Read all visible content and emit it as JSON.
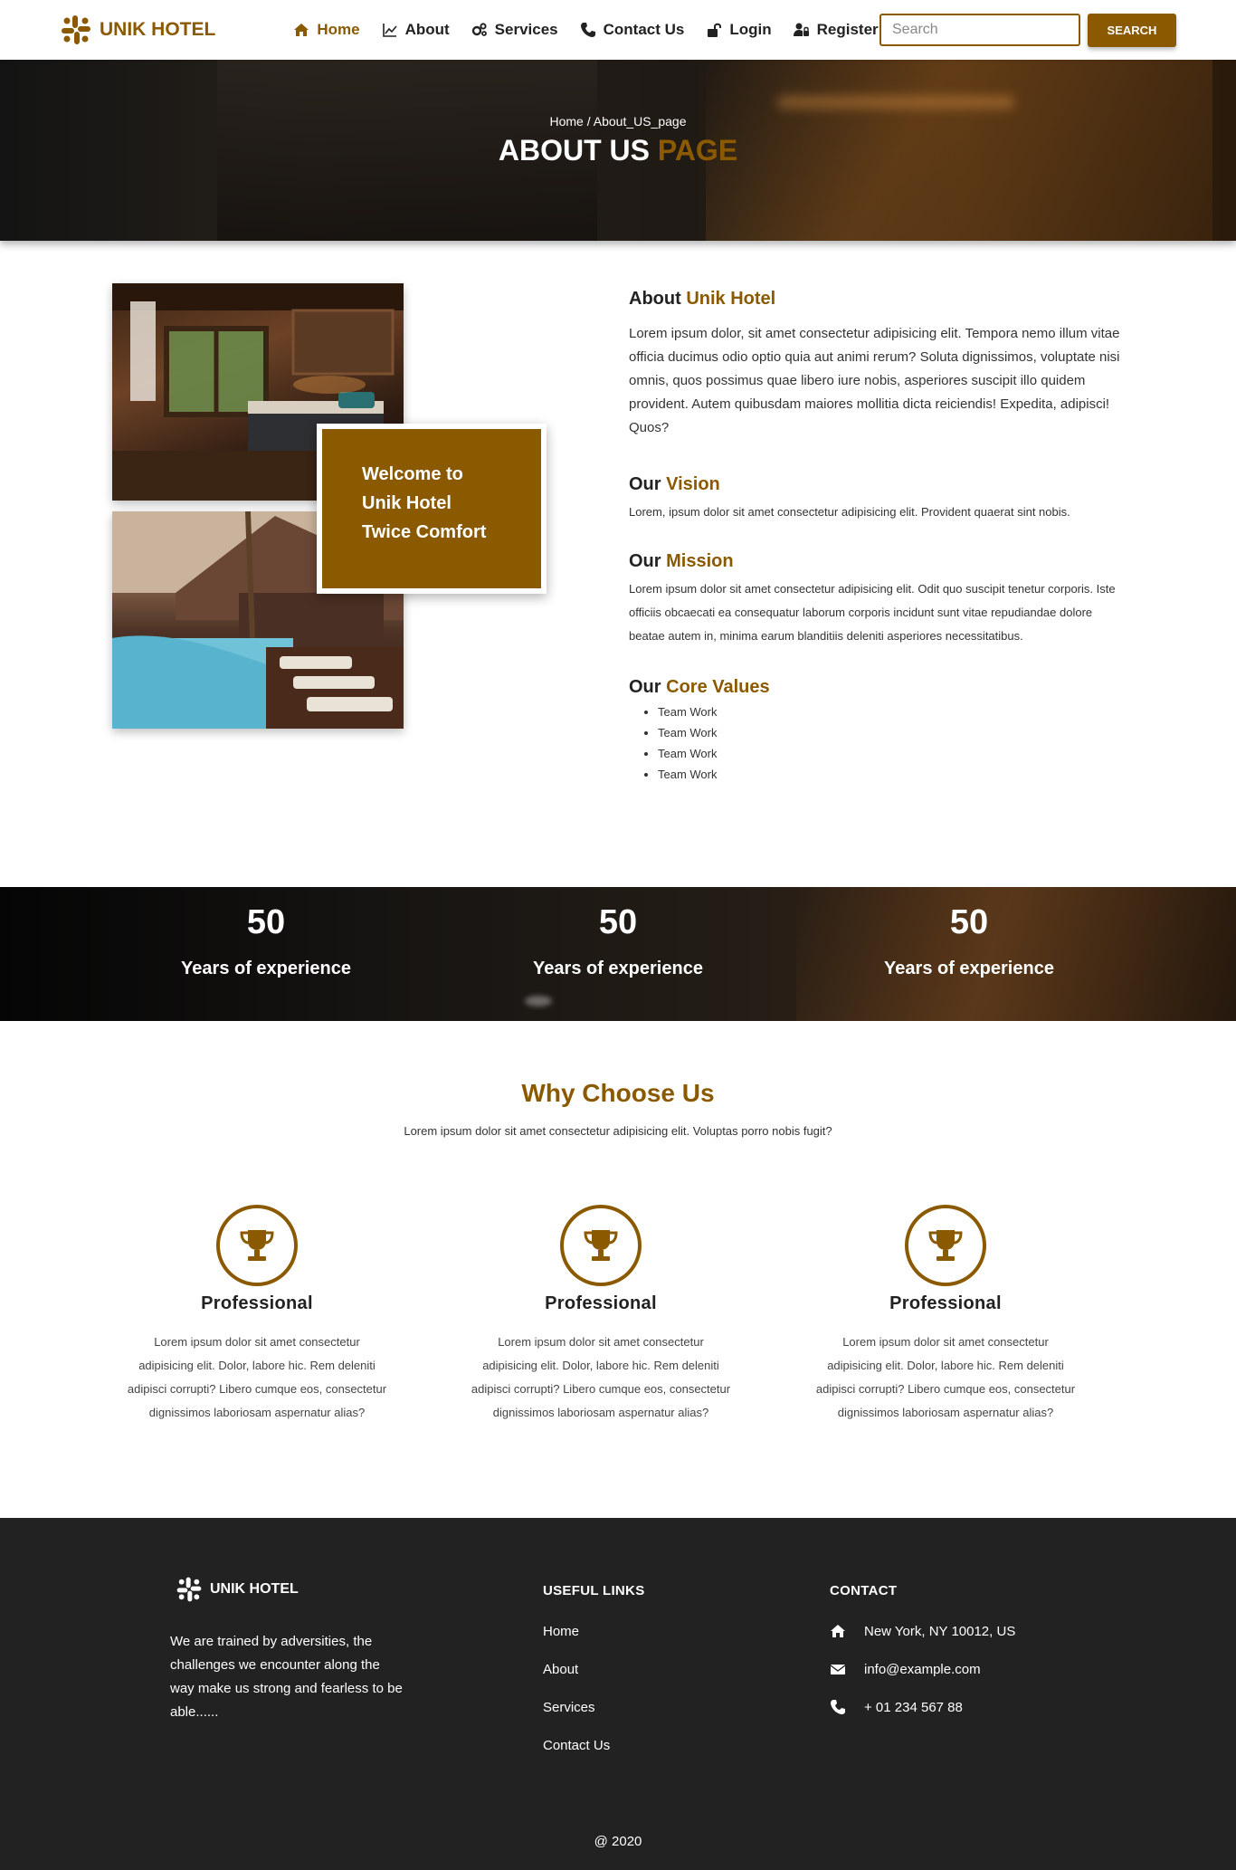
{
  "nav": {
    "brand": "UNIK HOTEL",
    "links": [
      "Home",
      "About",
      "Services",
      "Contact Us",
      "Login",
      "Register"
    ],
    "search_placeholder": "Search",
    "search_button": "SEARCH"
  },
  "hero": {
    "breadcrumb": "Home / About_US_page",
    "title_main": "ABOUT US",
    "title_accent": "PAGE"
  },
  "about": {
    "welcome_lines": [
      "Welcome to",
      "Unik Hotel",
      "Twice Comfort"
    ],
    "heading_main": "About",
    "heading_accent": "Unik Hotel",
    "paragraph": "Lorem ipsum dolor, sit amet consectetur adipisicing elit. Tempora nemo illum vitae officia ducimus odio optio quia aut animi rerum? Soluta dignissimos, voluptate nisi omnis, quos possimus quae libero iure nobis, asperiores suscipit illo quidem provident. Autem quibusdam maiores mollitia dicta reiciendis! Expedita, adipisci! Quos?",
    "vision": {
      "prefix": "Our",
      "accent": "Vision",
      "text": "Lorem, ipsum dolor sit amet consectetur adipisicing elit. Provident quaerat sint nobis."
    },
    "mission": {
      "prefix": "Our",
      "accent": "Mission",
      "text": "Lorem ipsum dolor sit amet consectetur adipisicing elit. Odit quo suscipit tenetur corporis. Iste officiis obcaecati ea consequatur laborum corporis incidunt sunt vitae repudiandae dolore beatae autem in, minima earum blanditiis deleniti asperiores necessitatibus."
    },
    "values": {
      "prefix": "Our",
      "accent": "Core Values",
      "items": [
        "Team Work",
        "Team Work",
        "Team Work",
        "Team Work"
      ]
    }
  },
  "stats": [
    {
      "number": "50",
      "label": "Years of experience"
    },
    {
      "number": "50",
      "label": "Years of experience"
    },
    {
      "number": "50",
      "label": "Years of experience"
    }
  ],
  "why": {
    "title": "Why Choose Us",
    "subtitle": "Lorem ipsum dolor sit amet consectetur adipisicing elit. Voluptas porro nobis fugit?",
    "cards": [
      {
        "title": "Professional",
        "text": "Lorem ipsum dolor sit amet consectetur adipisicing elit. Dolor, labore hic. Rem deleniti adipisci corrupti? Libero cumque eos, consectetur dignissimos laboriosam aspernatur alias?"
      },
      {
        "title": "Professional",
        "text": "Lorem ipsum dolor sit amet consectetur adipisicing elit. Dolor, labore hic. Rem deleniti adipisci corrupti? Libero cumque eos, consectetur dignissimos laboriosam aspernatur alias?"
      },
      {
        "title": "Professional",
        "text": "Lorem ipsum dolor sit amet consectetur adipisicing elit. Dolor, labore hic. Rem deleniti adipisci corrupti? Libero cumque eos, consectetur dignissimos laboriosam aspernatur alias?"
      }
    ]
  },
  "footer": {
    "brand": "UNIK HOTEL",
    "about": "We are trained by adversities, the challenges we encounter along the way make us strong and fearless to be able......",
    "links_heading": "USEFUL LINKS",
    "links": [
      "Home",
      "About",
      "Services",
      "Contact Us"
    ],
    "contact_heading": "CONTACT",
    "address": "New York, NY 10012, US",
    "email": "info@example.com",
    "phone": "+ 01 234 567 88",
    "copyright": "@ 2020"
  },
  "colors": {
    "accent": "#8b5a00",
    "footer_bg": "#222222"
  },
  "icons": {
    "brand": "slack-logo-icon",
    "nav": [
      "home-icon",
      "chart-line-icon",
      "cogs-icon",
      "phone-icon",
      "unlock-icon",
      "user-lock-icon"
    ],
    "why": "trophy-icon",
    "contact": [
      "home-icon",
      "envelope-icon",
      "phone-icon"
    ]
  }
}
